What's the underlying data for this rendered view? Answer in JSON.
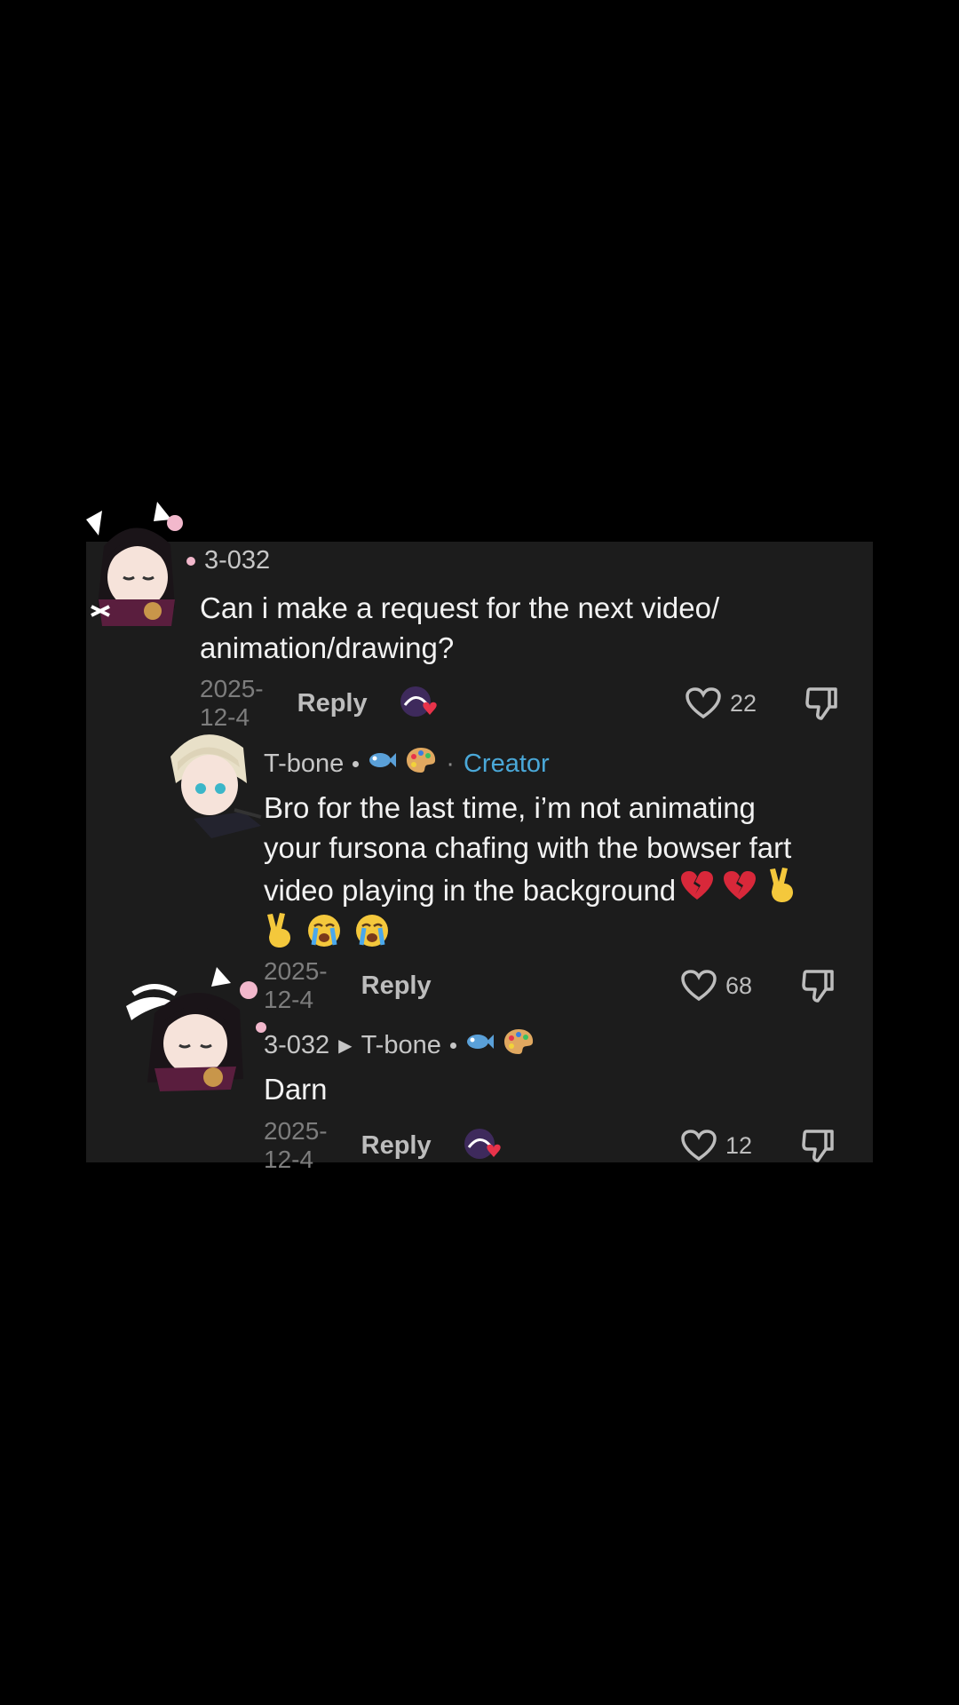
{
  "comments": [
    {
      "username": "3-032",
      "text_lines": [
        "Can i make a request for the next video/",
        "animation/drawing?"
      ],
      "date": "2025-12-4",
      "reply_label": "Reply",
      "likes": "22"
    },
    {
      "username": "T-bone",
      "badge": "Creator",
      "text_lines": [
        "Bro for the last time, i’m not animating",
        "your fursona chafing with the bowser fart",
        "video playing in the background"
      ],
      "date": "2025-12-4",
      "reply_label": "Reply",
      "likes": "68"
    },
    {
      "username": "3-032",
      "reply_to": "T-bone",
      "text": "Darn",
      "date": "2025-12-4",
      "reply_label": "Reply",
      "likes": "12"
    }
  ],
  "icons": {
    "like": "heart-outline-icon",
    "dislike": "thumbs-down-icon",
    "creator_liked": "creator-liked-avatar-icon"
  },
  "colors": {
    "panel_bg": "#1c1c1c",
    "creator_badge": "#4aa8d8",
    "heart": "#e8334a"
  }
}
